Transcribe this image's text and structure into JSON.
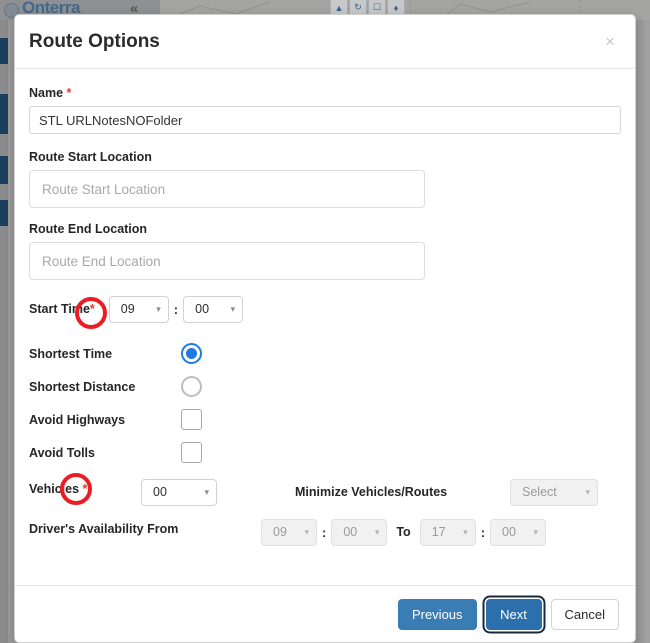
{
  "background": {
    "logo_text": "Onterra",
    "logo_mark": "globe-icon",
    "collapse_icon": "«",
    "toolbar_icons": [
      "pointer-icon",
      "refresh-icon",
      "save-icon",
      "pin-icon"
    ]
  },
  "modal": {
    "title": "Route Options",
    "close_label": "×",
    "fields": {
      "name": {
        "label": "Name",
        "required_marker": "*",
        "value": "STL URLNotesNOFolder",
        "placeholder": "Name"
      },
      "route_start_location": {
        "label": "Route Start Location",
        "value": "",
        "placeholder": "Route Start Location"
      },
      "route_end_location": {
        "label": "Route End Location",
        "value": "",
        "placeholder": "Route End Location"
      },
      "start_time": {
        "label": "Start Time",
        "required_marker": "*",
        "hour": "09",
        "minute": "00",
        "separator": ":"
      },
      "shortest_time": {
        "label": "Shortest Time",
        "selected": true
      },
      "shortest_distance": {
        "label": "Shortest Distance",
        "selected": false
      },
      "avoid_highways": {
        "label": "Avoid Highways",
        "checked": false
      },
      "avoid_tolls": {
        "label": "Avoid Tolls",
        "checked": false
      },
      "vehicles": {
        "label": "Vehicles",
        "required_marker": "*",
        "value": "00"
      },
      "minimize_vehicles_routes": {
        "label": "Minimize Vehicles/Routes",
        "value": "Select",
        "disabled": true
      },
      "drivers_availability": {
        "label": "Driver's Availability From",
        "from_hour": "09",
        "from_minute": "00",
        "to_label": "To",
        "to_hour": "17",
        "to_minute": "00",
        "separator": ":",
        "disabled": true
      }
    },
    "footer": {
      "previous_label": "Previous",
      "next_label": "Next",
      "cancel_label": "Cancel"
    }
  },
  "icons": {
    "chevron_down": "⌄"
  },
  "colors": {
    "accent_blue": "#1f7ae0",
    "button_blue": "#3a7cb4",
    "button_blue_active": "#2c6fad",
    "required_red": "#e33a2e",
    "annotation_red": "#ec1c24",
    "sidebar_navy": "#1d3f5e"
  }
}
